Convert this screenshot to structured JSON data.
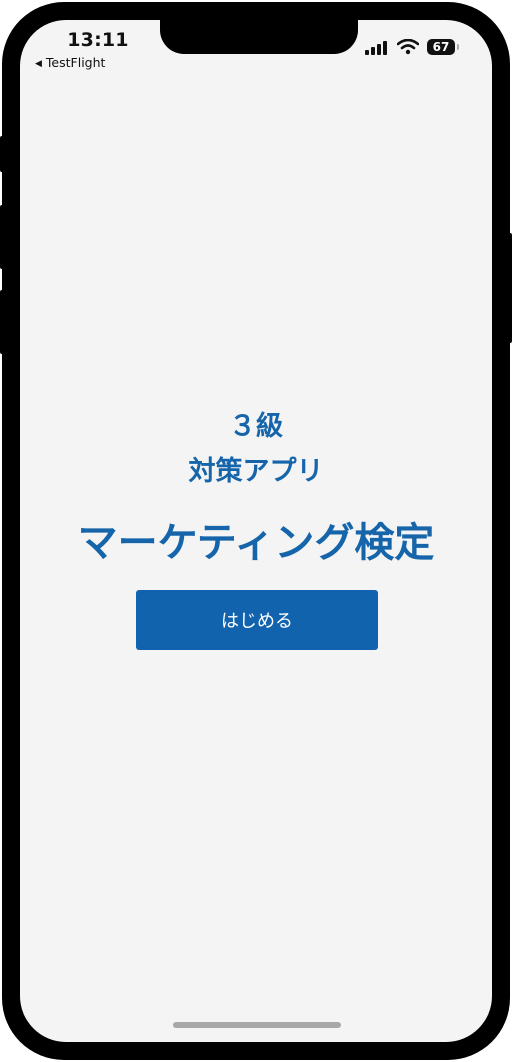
{
  "status_bar": {
    "time": "13:11",
    "back_app_label": "TestFlight",
    "battery_level": "67",
    "icons": [
      "cellular-signal-icon",
      "wifi-icon",
      "battery-icon"
    ]
  },
  "main": {
    "grade": "３級",
    "subtitle": "対策アプリ",
    "title": "マーケティング検定",
    "start_button_label": "はじめる"
  },
  "colors": {
    "accent": "#1665ab",
    "button_background": "#1163ad",
    "screen_background": "#f4f4f4"
  }
}
